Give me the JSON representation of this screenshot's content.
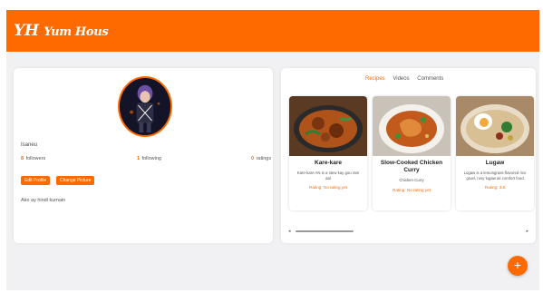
{
  "header": {
    "logo_initials": "YH",
    "logo_text": "Yum Hous"
  },
  "profile": {
    "username": "Isaneu",
    "followers_count": "8",
    "followers_label": "followers",
    "following_count": "1",
    "following_label": "following",
    "ratings_count": "0",
    "ratings_label": "ratings",
    "edit_button": "Edit Profile",
    "change_picture_button": "Change Picture",
    "bio": "Ako ay hindi kumain"
  },
  "tabs": [
    {
      "label": "Recipes",
      "active": true
    },
    {
      "label": "Videos",
      "active": false
    },
    {
      "label": "Comments",
      "active": false
    }
  ],
  "recipes": [
    {
      "title": "Kare-kare",
      "description": "Kare-kare AN is a stew kay gou ram aal",
      "rating": "Rating: No rating yet"
    },
    {
      "title": "Slow-Cooked Chicken Curry",
      "description": "Chicken Curry",
      "rating": "Rating: No rating yet"
    },
    {
      "title": "Lugaw",
      "description": "Lugaw is a lemongrass-flavored rice gruel, rosy lugaw as comfort food",
      "rating": "Rating: 3.8"
    }
  ],
  "colors": {
    "accent": "#ff6a00",
    "background": "#f1f1f3",
    "card": "#ffffff"
  },
  "icons": {
    "fab": "plus-icon",
    "scroll_left": "caret-left-icon",
    "scroll_right": "caret-right-icon"
  },
  "fab_label": "+",
  "scroll_left_glyph": "◂",
  "scroll_right_glyph": "▸"
}
